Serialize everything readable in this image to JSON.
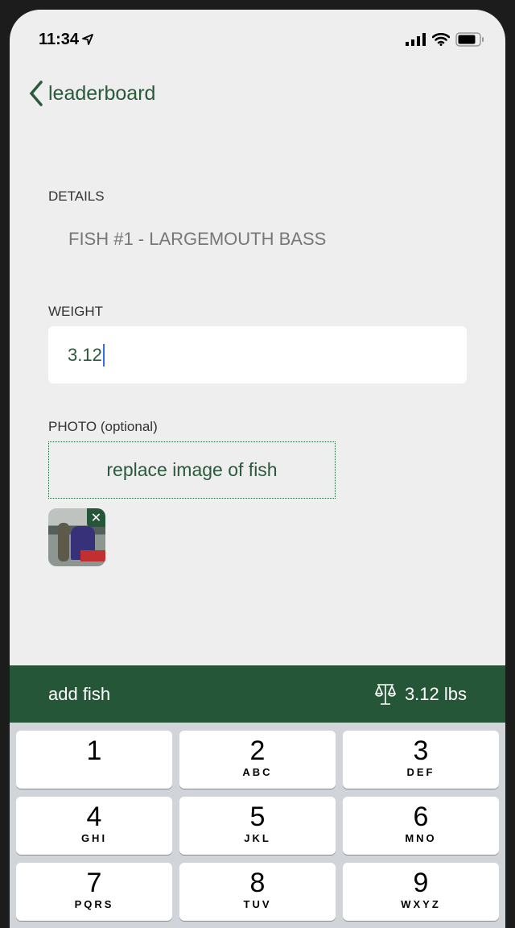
{
  "status": {
    "time": "11:34"
  },
  "nav": {
    "back_label": "leaderboard"
  },
  "form": {
    "details_label": "DETAILS",
    "details_value": "FISH #1 - LARGEMOUTH BASS",
    "weight_label": "WEIGHT",
    "weight_value": "3.12",
    "photo_label": "PHOTO (optional)",
    "photo_button": "replace image of fish"
  },
  "action_bar": {
    "add_label": "add fish",
    "total_weight": "3.12 lbs"
  },
  "colors": {
    "brand": "#265638",
    "background": "#eeeeee"
  },
  "keyboard": {
    "keys": [
      {
        "n": "1",
        "l": ""
      },
      {
        "n": "2",
        "l": "ABC"
      },
      {
        "n": "3",
        "l": "DEF"
      },
      {
        "n": "4",
        "l": "GHI"
      },
      {
        "n": "5",
        "l": "JKL"
      },
      {
        "n": "6",
        "l": "MNO"
      },
      {
        "n": "7",
        "l": "PQRS"
      },
      {
        "n": "8",
        "l": "TUV"
      },
      {
        "n": "9",
        "l": "WXYZ"
      }
    ]
  }
}
